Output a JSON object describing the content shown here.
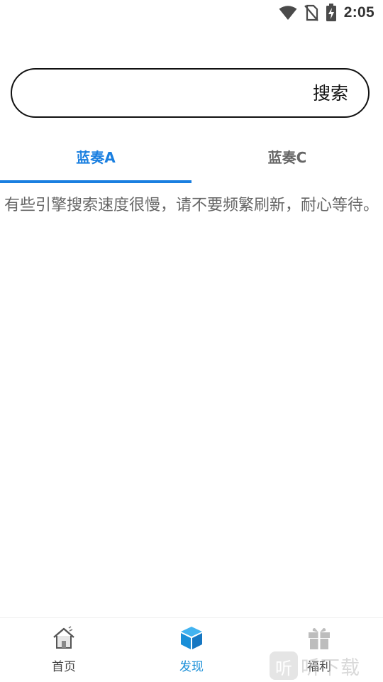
{
  "status_bar": {
    "time": "2:05",
    "icons": [
      "wifi-icon",
      "no-sim-icon",
      "battery-charging-icon"
    ]
  },
  "search": {
    "placeholder": "",
    "value": "",
    "button_label": "搜索"
  },
  "tabs": [
    {
      "label": "蓝奏A",
      "active": true
    },
    {
      "label": "蓝奏C",
      "active": false
    }
  ],
  "notice": "有些引擎搜索速度很慢，请不要频繁刷新，耐心等待。",
  "bottom_nav": {
    "items": [
      {
        "label": "首页",
        "icon": "home-icon",
        "active": false
      },
      {
        "label": "发现",
        "icon": "cube-icon",
        "active": true
      },
      {
        "label": "福利",
        "icon": "gift-icon",
        "active": false
      }
    ]
  },
  "watermark": {
    "text": "听下载",
    "logo_text": "听"
  },
  "colors": {
    "accent": "#1a7fe0",
    "discover_active": "#1a8fd8",
    "inactive_text": "#666666",
    "icon_gray": "#bdbdbd"
  }
}
